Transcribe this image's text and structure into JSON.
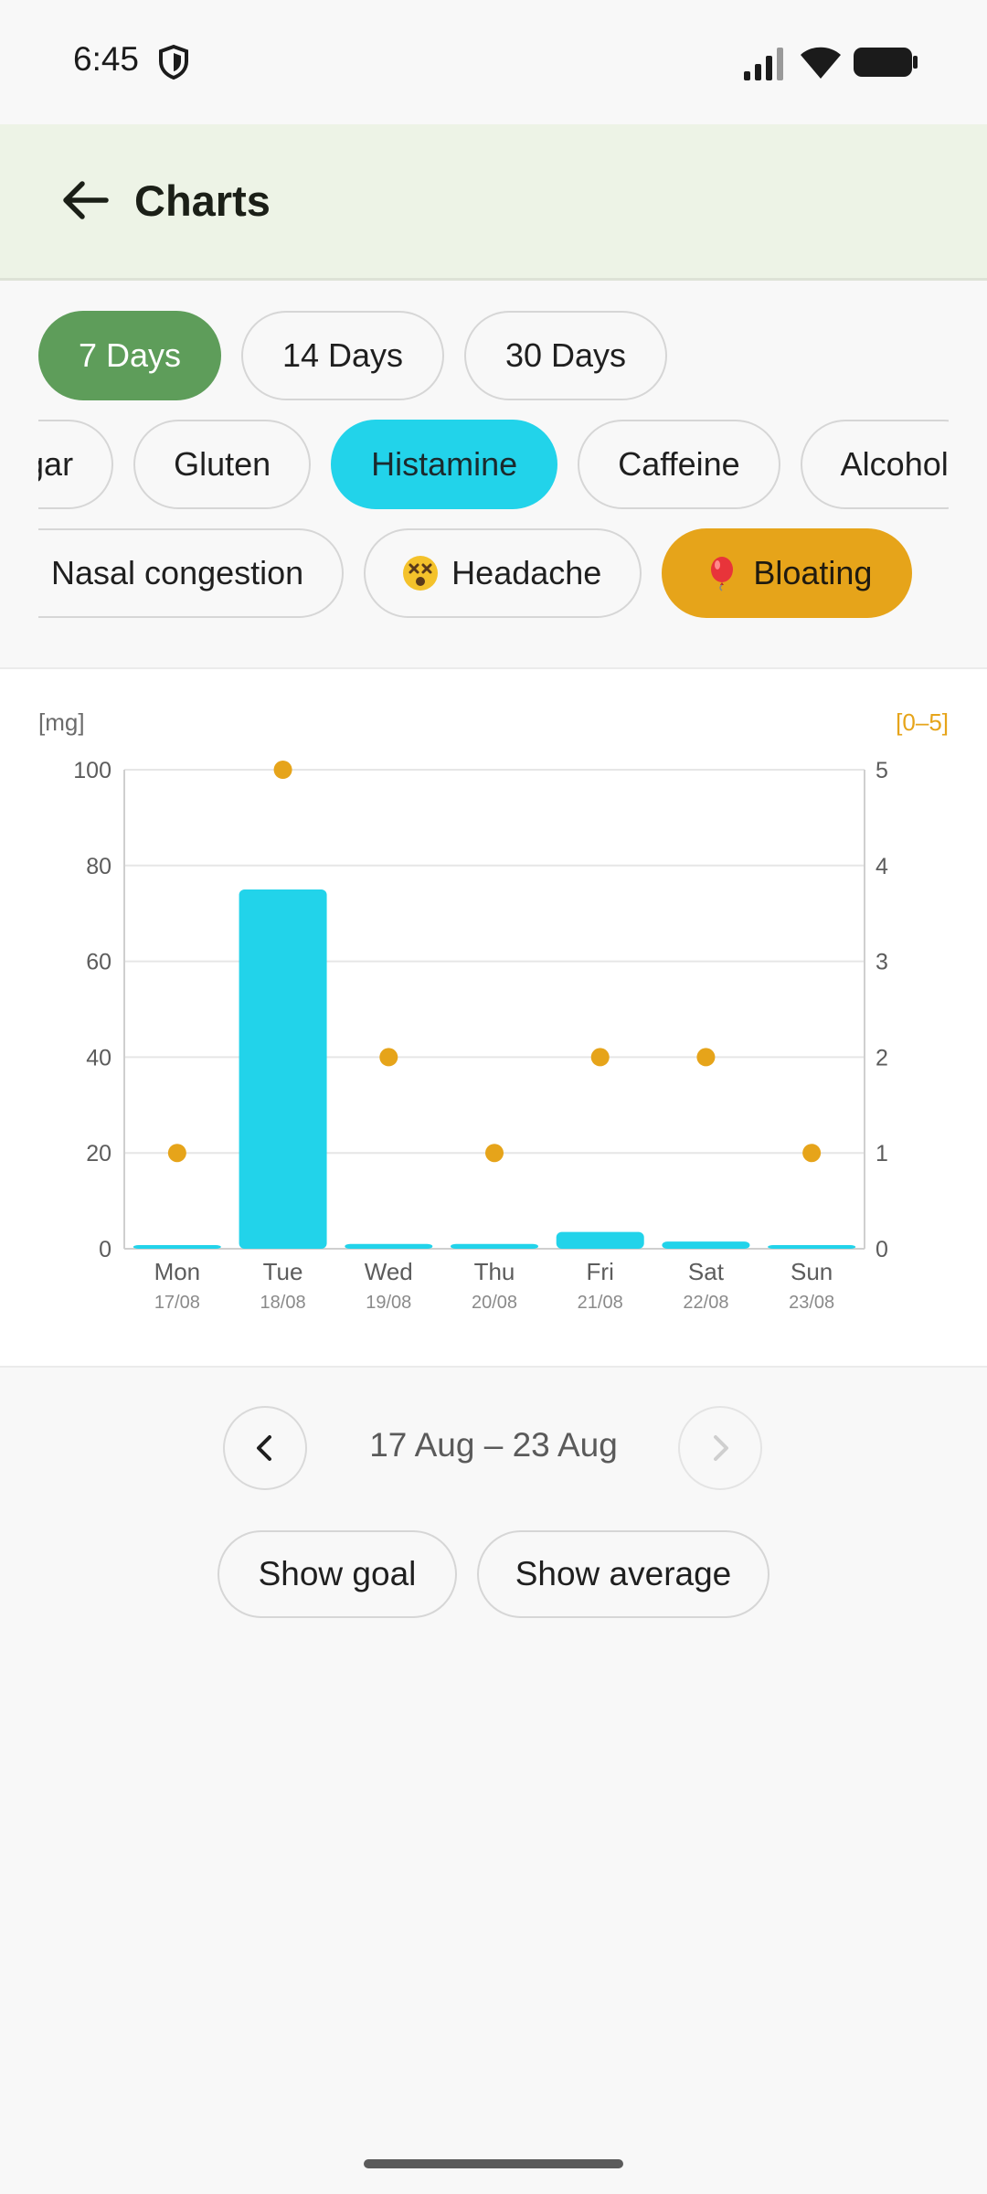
{
  "status_bar": {
    "time": "6:45"
  },
  "app_bar": {
    "title": "Charts"
  },
  "period_chips": [
    {
      "label": "7 Days",
      "selected": true
    },
    {
      "label": "14 Days",
      "selected": false
    },
    {
      "label": "30 Days",
      "selected": false
    }
  ],
  "ingredient_chips": [
    {
      "label": "Sugar",
      "selected": false
    },
    {
      "label": "Gluten",
      "selected": false
    },
    {
      "label": "Histamine",
      "selected": true
    },
    {
      "label": "Caffeine",
      "selected": false
    },
    {
      "label": "Alcohol",
      "selected": false
    }
  ],
  "symptom_chips": [
    {
      "label": "Nasal congestion",
      "icon": "sneezing-face-emoji",
      "selected": false
    },
    {
      "label": "Headache",
      "icon": "dizzy-face-emoji",
      "selected": false
    },
    {
      "label": "Bloating",
      "icon": "balloon-emoji",
      "selected": true
    }
  ],
  "chart_data": {
    "type": "bar",
    "left_axis_label": "[mg]",
    "right_axis_label": "[0–5]",
    "categories": [
      "Mon",
      "Tue",
      "Wed",
      "Thu",
      "Fri",
      "Sat",
      "Sun"
    ],
    "dates": [
      "17/08",
      "18/08",
      "19/08",
      "20/08",
      "21/08",
      "22/08",
      "23/08"
    ],
    "series": [
      {
        "name": "Histamine",
        "axis": "left",
        "type": "bar",
        "color": "#22d3ea",
        "values": [
          0.5,
          75,
          1,
          1,
          3.5,
          1.5,
          0.5
        ]
      },
      {
        "name": "Bloating",
        "axis": "right",
        "type": "scatter",
        "color": "#e6a41a",
        "values": [
          1,
          5,
          2,
          1,
          2,
          2,
          1
        ]
      }
    ],
    "ylim": [
      0,
      100
    ],
    "y_ticks": [
      0,
      20,
      40,
      60,
      80,
      100
    ],
    "y2lim": [
      0,
      5
    ],
    "y2_ticks": [
      0,
      1,
      2,
      3,
      4,
      5
    ],
    "grid": true
  },
  "pager": {
    "range_label": "17 Aug – 23 Aug",
    "prev_enabled": true,
    "next_enabled": false
  },
  "actions": {
    "show_goal": "Show goal",
    "show_average": "Show average"
  },
  "colors": {
    "accent_green": "#5e9d5a",
    "histamine_cyan": "#22d3ea",
    "bloating_amber": "#e6a41a",
    "appbar_bg": "#edf3e6"
  }
}
